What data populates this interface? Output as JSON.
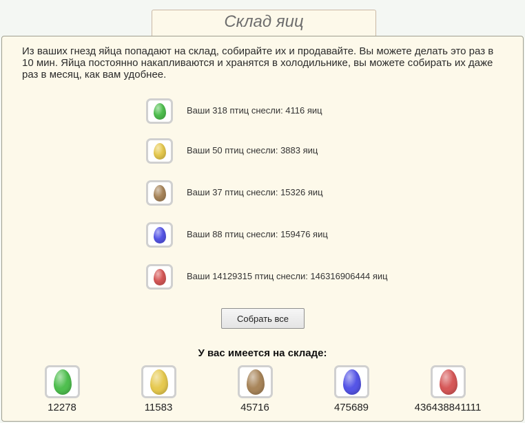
{
  "page": {
    "title": "Склад яиц",
    "intro": "Из ваших гнезд яйца попадают на склад, собирайте их и продавайте. Вы можете делать это раз в 10 мин. Яйца постоянно накапливаются и хранятся в холодильнике, вы можете собирать их даже раз в месяц, как вам удобнее."
  },
  "nests": [
    {
      "egg": "green-egg-icon",
      "color": "#4fbf4f",
      "text": "Ваши 318 птиц снесли: 4116 яиц"
    },
    {
      "egg": "yellow-egg-icon",
      "color": "#e6c94f",
      "text": "Ваши 50 птиц снесли: 3883 яиц"
    },
    {
      "egg": "brown-egg-icon",
      "color": "#a8855a",
      "text": "Ваши 37 птиц снесли: 15326 яиц"
    },
    {
      "egg": "blue-egg-icon",
      "color": "#5555e6",
      "text": "Ваши 88 птиц снесли: 159476 яиц"
    },
    {
      "egg": "red-egg-icon",
      "color": "#d65858",
      "text": "Ваши 14129315 птиц снесли: 146316906444 яиц"
    }
  ],
  "collect_button": "Собрать все",
  "stock": {
    "heading": "У вас имеется на складе:",
    "items": [
      {
        "egg": "green-egg-icon",
        "color": "#4fbf4f",
        "count": "12278"
      },
      {
        "egg": "yellow-egg-icon",
        "color": "#e6c94f",
        "count": "11583"
      },
      {
        "egg": "brown-egg-icon",
        "color": "#a8855a",
        "count": "45716"
      },
      {
        "egg": "blue-egg-icon",
        "color": "#5555e6",
        "count": "475689"
      },
      {
        "egg": "red-egg-icon",
        "color": "#d65858",
        "count": "436438841111"
      }
    ]
  }
}
